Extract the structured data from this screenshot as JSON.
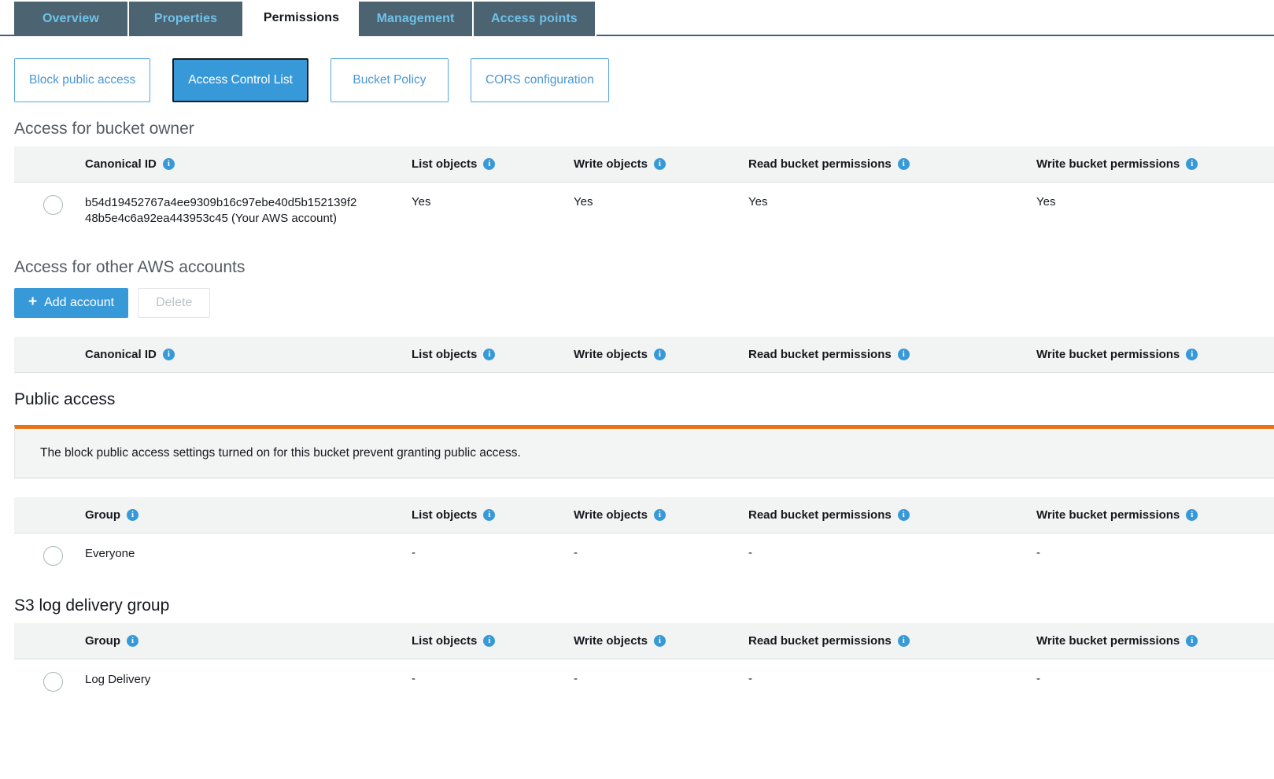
{
  "tabs": [
    {
      "label": "Overview",
      "active": false
    },
    {
      "label": "Properties",
      "active": false
    },
    {
      "label": "Permissions",
      "active": true
    },
    {
      "label": "Management",
      "active": false
    },
    {
      "label": "Access points",
      "active": false
    }
  ],
  "sub_buttons": [
    {
      "label": "Block public access",
      "selected": false
    },
    {
      "label": "Access Control List",
      "selected": true
    },
    {
      "label": "Bucket Policy",
      "selected": false
    },
    {
      "label": "CORS configuration",
      "selected": false
    }
  ],
  "colors": {
    "tab_bg": "#4c6472",
    "tab_text": "#6fc1e8",
    "accent_blue": "#3899d8",
    "alert_orange": "#ec7211",
    "header_bg": "#f2f3f3"
  },
  "icons": {
    "info": "info-icon",
    "plus": "plus-icon",
    "radio": "radio-button"
  },
  "bucket_owner": {
    "title": "Access for bucket owner",
    "headers": {
      "name": "Canonical ID",
      "list_objects": "List objects",
      "write_objects": "Write objects",
      "read_bucket_permissions": "Read bucket permissions",
      "write_bucket_permissions": "Write bucket permissions"
    },
    "rows": [
      {
        "name_line1": "b54d19452767a4ee9309b16c97ebe40d5b152139f2",
        "name_line2": "48b5e4c6a92ea443953c45 (Your AWS account)",
        "list_objects": "Yes",
        "write_objects": "Yes",
        "read_bucket_permissions": "Yes",
        "write_bucket_permissions": "Yes"
      }
    ]
  },
  "other_accounts": {
    "title": "Access for other AWS accounts",
    "add_button": "Add account",
    "delete_button": "Delete",
    "headers": {
      "name": "Canonical ID",
      "list_objects": "List objects",
      "write_objects": "Write objects",
      "read_bucket_permissions": "Read bucket permissions",
      "write_bucket_permissions": "Write bucket permissions"
    },
    "rows": []
  },
  "public_access": {
    "title": "Public access",
    "alert_message": "The block public access settings turned on for this bucket prevent granting public access.",
    "headers": {
      "name": "Group",
      "list_objects": "List objects",
      "write_objects": "Write objects",
      "read_bucket_permissions": "Read bucket permissions",
      "write_bucket_permissions": "Write bucket permissions"
    },
    "rows": [
      {
        "name_line1": "Everyone",
        "name_line2": "",
        "list_objects": "-",
        "write_objects": "-",
        "read_bucket_permissions": "-",
        "write_bucket_permissions": "-"
      }
    ]
  },
  "log_delivery": {
    "title": "S3 log delivery group",
    "headers": {
      "name": "Group",
      "list_objects": "List objects",
      "write_objects": "Write objects",
      "read_bucket_permissions": "Read bucket permissions",
      "write_bucket_permissions": "Write bucket permissions"
    },
    "rows": [
      {
        "name_line1": "Log Delivery",
        "name_line2": "",
        "list_objects": "-",
        "write_objects": "-",
        "read_bucket_permissions": "-",
        "write_bucket_permissions": "-"
      }
    ]
  }
}
